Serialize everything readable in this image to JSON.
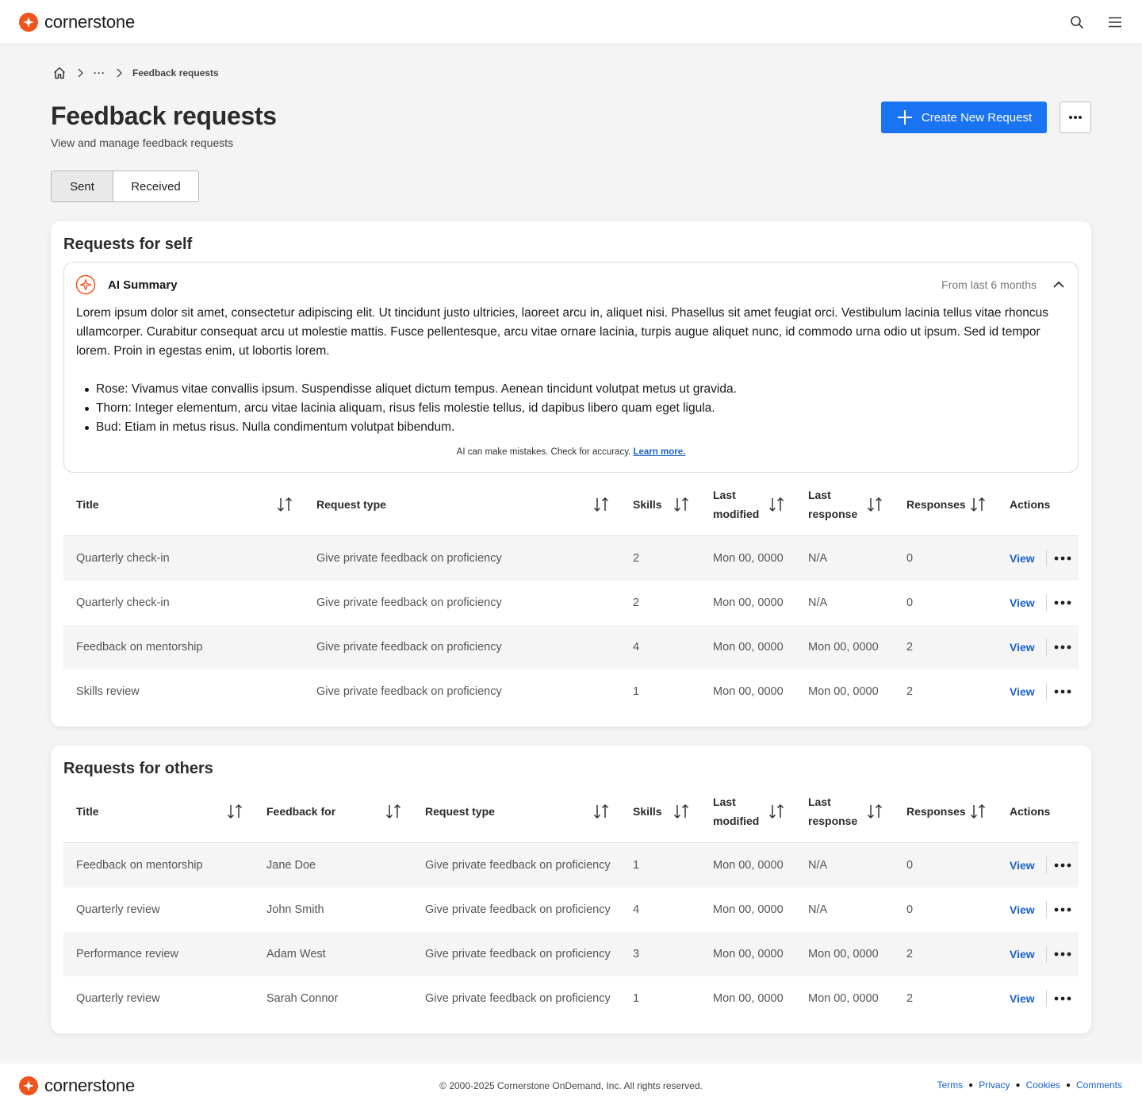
{
  "header": {
    "brand": "cornerstone",
    "search_icon": "search-icon",
    "menu_icon": "menu-icon",
    "brand_color": "#f0531c"
  },
  "breadcrumb": {
    "ellipsis": "···",
    "current": "Feedback requests"
  },
  "page": {
    "title": "Feedback requests",
    "subtitle": "View and manage feedback requests",
    "create_button": "Create New Request",
    "accent": "#1a73f0"
  },
  "tabs": {
    "sent": "Sent",
    "received": "Received",
    "active": "Sent"
  },
  "self_section": {
    "title": "Requests for self",
    "ai_summary": {
      "title": "AI Summary",
      "range": "From last 6 months",
      "paragraph": "Lorem ipsum dolor sit amet, consectetur adipiscing elit. Ut tincidunt  justo ultricies, laoreet arcu in, aliquet nisi. Phasellus sit amet  feugiat orci. Vestibulum lacinia tellus vitae rhoncus ullamcorper.  Curabitur consequat arcu ut molestie mattis. Fusce pellentesque, arcu  vitae ornare lacinia, turpis augue aliquet nunc, id commodo urna odio ut ipsum. Sed id tempor lorem. Proin in egestas enim, ut lobortis lorem.",
      "bullets": [
        "Rose: Vivamus vitae convallis ipsum. Suspendisse aliquet dictum tempus. Aenean tincidunt volutpat metus ut gravida.",
        "Thorn: Integer elementum, arcu vitae  lacinia aliquam, risus felis molestie tellus, id dapibus libero quam  eget ligula.",
        "Bud: Etiam in metus risus. Nulla condimentum volutpat bibendum."
      ],
      "disclaimer": "AI can make mistakes. Check for accuracy.",
      "learn_more": "Learn more."
    },
    "columns": {
      "title": "Title",
      "request_type": "Request type",
      "skills": "Skills",
      "last_modified_1": "Last",
      "last_modified_2": "modified",
      "last_response_1": "Last",
      "last_response_2": "response",
      "responses": "Responses",
      "actions": "Actions"
    },
    "rows": [
      {
        "title": "Quarterly check-in",
        "request_type": "Give private feedback on proficiency",
        "skills": "2",
        "last_modified": "Mon 00, 0000",
        "last_response": "N/A",
        "responses": "0",
        "action": "View"
      },
      {
        "title": "Quarterly check-in",
        "request_type": "Give private feedback on proficiency",
        "skills": "2",
        "last_modified": "Mon 00, 0000",
        "last_response": "N/A",
        "responses": "0",
        "action": "View"
      },
      {
        "title": "Feedback on mentorship",
        "request_type": "Give private feedback on proficiency",
        "skills": "4",
        "last_modified": "Mon 00, 0000",
        "last_response": "Mon 00, 0000",
        "responses": "2",
        "action": "View"
      },
      {
        "title": "Skills review",
        "request_type": "Give private feedback on proficiency",
        "skills": "1",
        "last_modified": "Mon 00, 0000",
        "last_response": "Mon 00, 0000",
        "responses": "2",
        "action": "View"
      }
    ]
  },
  "others_section": {
    "title": "Requests for others",
    "columns": {
      "title": "Title",
      "feedback_for": "Feedback for",
      "request_type": "Request type",
      "skills": "Skills",
      "last_modified_1": "Last",
      "last_modified_2": "modified",
      "last_response_1": "Last",
      "last_response_2": "response",
      "responses": "Responses",
      "actions": "Actions"
    },
    "rows": [
      {
        "title": "Feedback on mentorship",
        "feedback_for": "Jane Doe",
        "request_type": "Give private feedback on proficiency",
        "skills": "1",
        "last_modified": "Mon 00, 0000",
        "last_response": "N/A",
        "responses": "0",
        "action": "View"
      },
      {
        "title": "Quarterly review",
        "feedback_for": "John Smith",
        "request_type": "Give private feedback on proficiency",
        "skills": "4",
        "last_modified": "Mon 00, 0000",
        "last_response": "N/A",
        "responses": "0",
        "action": "View"
      },
      {
        "title": "Performance review",
        "feedback_for": "Adam West",
        "request_type": "Give private feedback on proficiency",
        "skills": "3",
        "last_modified": "Mon 00, 0000",
        "last_response": "Mon 00, 0000",
        "responses": "2",
        "action": "View"
      },
      {
        "title": "Quarterly review",
        "feedback_for": "Sarah Connor",
        "request_type": "Give private feedback on proficiency",
        "skills": "1",
        "last_modified": "Mon 00, 0000",
        "last_response": "Mon 00, 0000",
        "responses": "2",
        "action": "View"
      }
    ]
  },
  "footer": {
    "brand": "cornerstone",
    "copyright": "© 2000-2025 Cornerstone OnDemand, Inc.  All rights reserved.",
    "links": [
      "Terms",
      "Privacy",
      "Cookies",
      "Comments"
    ]
  }
}
